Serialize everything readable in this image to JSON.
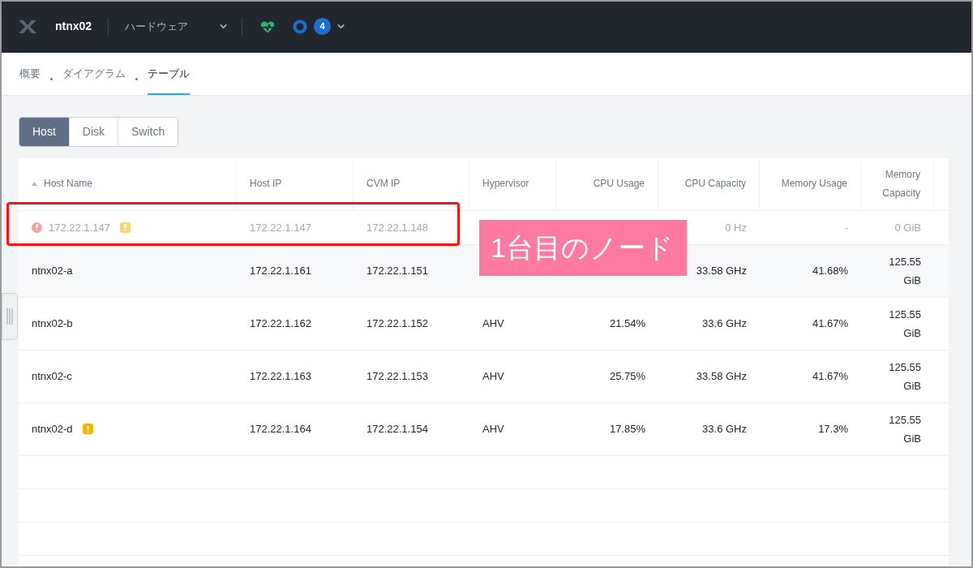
{
  "top_bar": {
    "cluster": "ntnx02",
    "menu": "ハードウェア",
    "alert_count": "4"
  },
  "subnav": [
    {
      "label": "概要",
      "selected": false
    },
    {
      "label": "ダイアグラム",
      "selected": false
    },
    {
      "label": "テーブル",
      "selected": true
    }
  ],
  "view_toggle": [
    {
      "label": "Host",
      "selected": true
    },
    {
      "label": "Disk",
      "selected": false
    },
    {
      "label": "Switch",
      "selected": false
    }
  ],
  "table": {
    "columns": [
      {
        "label": "Host Name",
        "sorted": true
      },
      {
        "label": "Host IP",
        "sorted": false
      },
      {
        "label": "CVM IP",
        "sorted": false
      },
      {
        "label": "Hypervisor",
        "sorted": false
      },
      {
        "label": "CPU Usage",
        "sorted": false
      },
      {
        "label": "CPU Capacity",
        "sorted": false
      },
      {
        "label": "Memory Usage",
        "sorted": false
      },
      {
        "label": "Memory Capacity",
        "sorted": false
      }
    ],
    "rows": [
      {
        "cells": [
          "172.22.1.147",
          "172.22.1.147",
          "172.22.1.148",
          null,
          null,
          "0 Hz",
          "-",
          "0 GiB"
        ],
        "disconnected": true,
        "error": true,
        "warning": true,
        "highlighted": true
      },
      {
        "cells": [
          "ntnx02-a",
          "172.22.1.161",
          "172.22.1.151",
          null,
          null,
          "33.58 GHz",
          "41.68%",
          "125.55 GiB"
        ],
        "disconnected": false,
        "error": false,
        "warning": false,
        "highlighted": false
      },
      {
        "cells": [
          "ntnx02-b",
          "172.22.1.162",
          "172.22.1.152",
          "AHV",
          "21.54%",
          "33.6 GHz",
          "41.67%",
          "125.55 GiB"
        ],
        "disconnected": false,
        "error": false,
        "warning": false,
        "highlighted": false
      },
      {
        "cells": [
          "ntnx02-c",
          "172.22.1.163",
          "172.22.1.153",
          "AHV",
          "25.75%",
          "33.58 GHz",
          "41.67%",
          "125.55 GiB"
        ],
        "disconnected": false,
        "error": false,
        "warning": false,
        "highlighted": false
      },
      {
        "cells": [
          "ntnx02-d",
          "172.22.1.164",
          "172.22.1.154",
          "AHV",
          "17.85%",
          "33.6 GHz",
          "17.3%",
          "125.55 GiB"
        ],
        "disconnected": false,
        "error": false,
        "warning": true,
        "highlighted": false
      }
    ]
  },
  "callout": {
    "text": "1台目のノード"
  }
}
